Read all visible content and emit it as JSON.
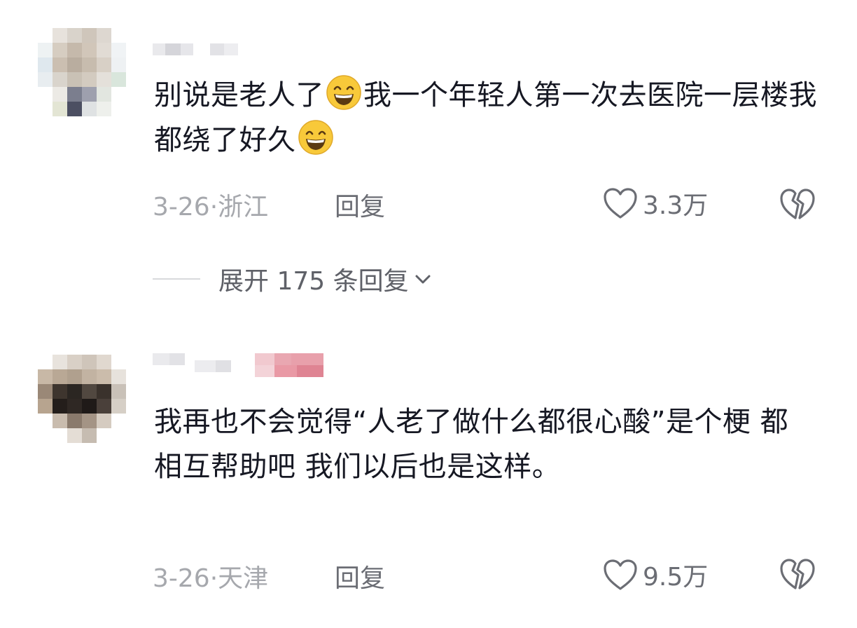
{
  "comments": [
    {
      "text_before": "别说是老人了",
      "text_after": "我一个年轻人第一次去医院一层楼我都绕了好久",
      "emoji": "grinning-smiling-eyes-emoji",
      "date_location": "3-26·浙江",
      "reply_label": "回复",
      "like_count": "3.3万",
      "expand_replies_label": "展开 175 条回复"
    },
    {
      "text": "我再也不会觉得“人老了做什么都很心酸”是个梗 都相互帮助吧 我们以后也是这样。",
      "date_location": "3-26·天津",
      "reply_label": "回复",
      "like_count": "9.5万"
    }
  ],
  "icons": {
    "like": "heart-outline-icon",
    "dislike": "broken-heart-icon",
    "expand": "chevron-down-icon"
  },
  "colors": {
    "text": "#161823",
    "meta": "#a6a8ad",
    "action": "#6b6d74",
    "emoji_face": "#f8c93a"
  }
}
